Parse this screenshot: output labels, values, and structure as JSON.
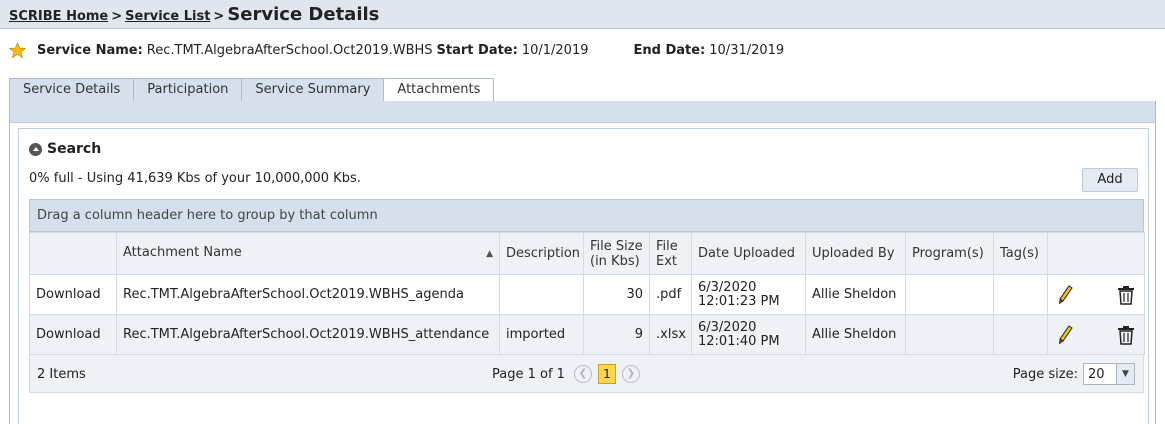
{
  "breadcrumb": {
    "home": "SCRIBE Home",
    "sep1": ">",
    "list": "Service List",
    "sep2": ">",
    "current": "Service Details"
  },
  "service": {
    "name_label": "Service Name:",
    "name": "Rec.TMT.AlgebraAfterSchool.Oct2019.WBHS",
    "start_label": "Start Date:",
    "start": "10/1/2019",
    "end_label": "End Date:",
    "end": "10/31/2019"
  },
  "tabs": [
    {
      "label": "Service Details"
    },
    {
      "label": "Participation"
    },
    {
      "label": "Service Summary"
    },
    {
      "label": "Attachments",
      "active": true
    }
  ],
  "search": {
    "title": "Search"
  },
  "usage": "0% full - Using 41,639 Kbs of your 10,000,000 Kbs.",
  "add_label": "Add",
  "grid": {
    "group_hint": "Drag a column header here to group by that column",
    "columns": [
      "",
      "Attachment Name",
      "Description",
      "File Size (in Kbs)",
      "File Ext",
      "Date Uploaded",
      "Uploaded By",
      "Program(s)",
      "Tag(s)",
      ""
    ],
    "sort_icon": "sort-ascending-icon",
    "rows": [
      {
        "action": "Download",
        "name": "Rec.TMT.AlgebraAfterSchool.Oct2019.WBHS_agenda",
        "description": "",
        "size": "30",
        "ext": ".pdf",
        "date": "6/3/2020 12:01:23 PM",
        "by": "Allie Sheldon",
        "programs": "",
        "tags": ""
      },
      {
        "action": "Download",
        "name": "Rec.TMT.AlgebraAfterSchool.Oct2019.WBHS_attendance",
        "description": "imported",
        "size": "9",
        "ext": ".xlsx",
        "date": "6/3/2020 12:01:40 PM",
        "by": "Allie Sheldon",
        "programs": "",
        "tags": ""
      }
    ],
    "footer": {
      "count": "2 Items",
      "page_text": "Page 1 of 1",
      "current_page": "1",
      "page_size_label": "Page size:",
      "page_size": "20"
    }
  },
  "icons": {
    "star": "star-icon",
    "edit": "pencil-icon",
    "delete": "trash-icon"
  },
  "colors": {
    "header_bg": "#dfe6ee",
    "tab_bg": "#d5e0ec",
    "alt_row": "#eef2f6",
    "pager_active": "#ffd54a"
  }
}
